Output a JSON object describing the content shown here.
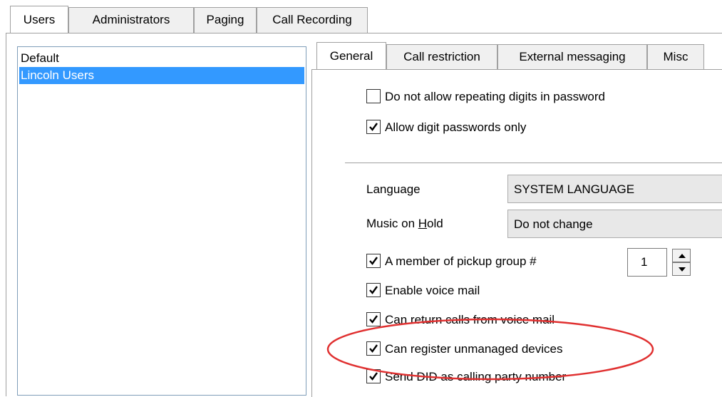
{
  "outer_tabs": [
    {
      "label": "Users",
      "active": true
    },
    {
      "label": "Administrators",
      "active": false
    },
    {
      "label": "Paging",
      "active": false
    },
    {
      "label": "Call Recording",
      "active": false
    }
  ],
  "groups": [
    {
      "label": "Default",
      "selected": false
    },
    {
      "label": "Lincoln Users",
      "selected": true
    }
  ],
  "inner_tabs": [
    {
      "label": "General",
      "active": true
    },
    {
      "label": "Call restriction",
      "active": false
    },
    {
      "label": "External messaging",
      "active": false
    },
    {
      "label": "Misc",
      "active": false
    }
  ],
  "password_options": [
    {
      "label": "Do not allow repeating digits in password",
      "checked": false
    },
    {
      "label": "Allow digit passwords only",
      "checked": true
    }
  ],
  "language": {
    "label": "Language",
    "value": "SYSTEM LANGUAGE"
  },
  "music_on_hold": {
    "label_prefix": "Music on ",
    "label_mnemonic": "H",
    "label_suffix": "old",
    "value": "Do not change"
  },
  "pickup_group": {
    "label": "A member of pickup group #",
    "checked": true,
    "value": "1"
  },
  "options": [
    {
      "label": "Enable voice mail",
      "checked": true
    },
    {
      "label": "Can return calls from voice mail",
      "checked": true
    },
    {
      "label": "Can register unmanaged devices",
      "checked": true
    },
    {
      "label": "Send DID as calling party number",
      "checked": true
    }
  ],
  "colors": {
    "selection": "#3399ff",
    "highlight_ellipse": "#e03030"
  },
  "icons": {
    "check": "checkmark-icon",
    "spin_up": "arrow-up-icon",
    "spin_down": "arrow-down-icon"
  }
}
